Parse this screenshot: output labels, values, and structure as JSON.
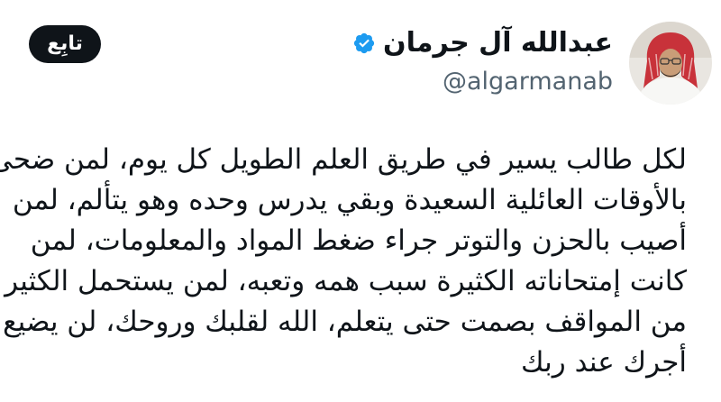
{
  "author": {
    "display_name": "عبدالله آل جرمان",
    "handle": "@algarmanab",
    "verified_icon": "verified-badge-icon",
    "avatar_icon": "profile-photo"
  },
  "follow_button": {
    "label": "تابِع"
  },
  "tweet": {
    "lines": [
      "لكل طالب يسير في طريق العلم الطويل كل يوم، لمن ضحى",
      "بالأوقات العائلية السعيدة وبقي يدرس وحده وهو يتألم، لمن",
      "أصيب بالحزن والتوتر جراء ضغط المواد والمعلومات، لمن",
      "كانت إمتحاناته الكثيرة سبب همه وتعبه، لمن يستحمل الكثير",
      "من المواقف بصمت حتى يتعلم، الله لقلبك وروحك، لن يضيع",
      "أجرك عند ربك"
    ]
  },
  "colors": {
    "verified": "#1d9bf0",
    "text": "#0f1419",
    "secondary_text": "#536471",
    "button_bg": "#0f1419",
    "button_text": "#ffffff"
  }
}
